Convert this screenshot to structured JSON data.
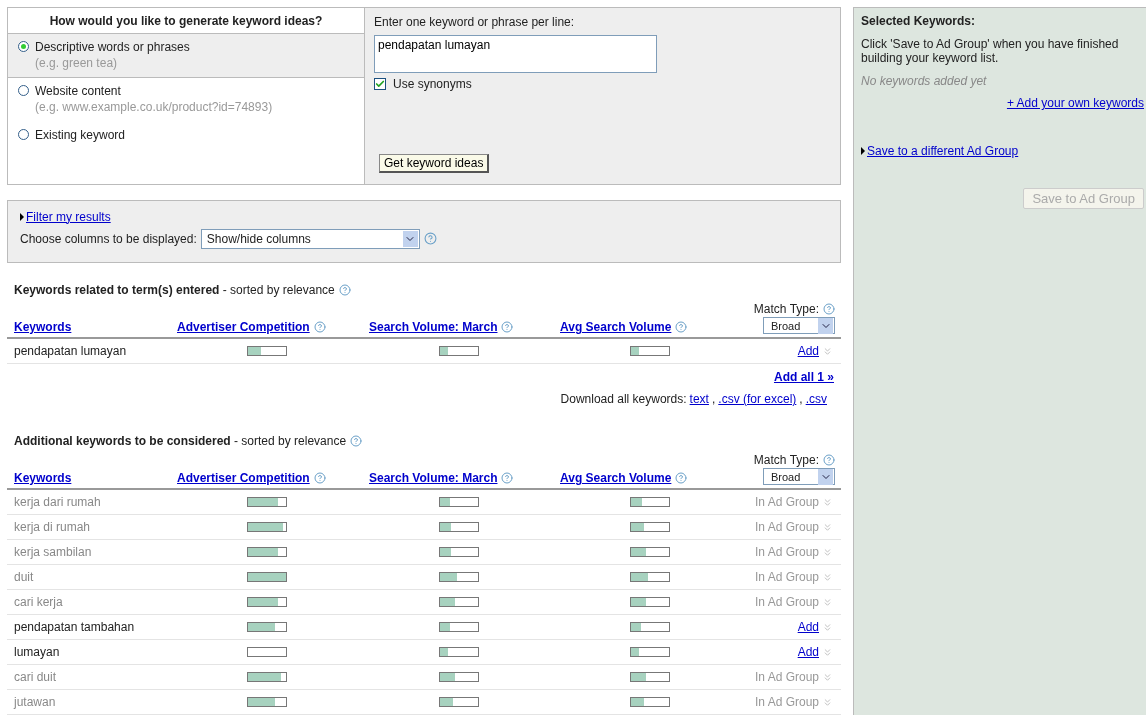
{
  "generator": {
    "title": "How would you like to generate keyword ideas?",
    "options": [
      {
        "label": "Descriptive words or phrases",
        "example": "(e.g. green tea)",
        "selected": true
      },
      {
        "label": "Website content",
        "example": "(e.g. www.example.co.uk/product?id=74893)",
        "selected": false
      },
      {
        "label": "Existing keyword",
        "selected": false
      }
    ],
    "input_label": "Enter one keyword or phrase per line:",
    "input_value": "pendapatan lumayan",
    "synonyms": {
      "label": "Use synonyms",
      "checked": true
    },
    "button": "Get keyword ideas"
  },
  "filter": {
    "link": "Filter my results",
    "columns_label": "Choose columns to be displayed:",
    "columns_select": "Show/hide columns"
  },
  "tables": [
    {
      "title": "Keywords related to term(s) entered",
      "subtitle": " - sorted by relevance",
      "match_type_label": "Match Type:",
      "match_type": "Broad",
      "columns": [
        "Keywords",
        "Advertiser Competition",
        "Search Volume: March",
        "Avg Search Volume"
      ],
      "rows": [
        {
          "keyword": "pendapatan lumayan",
          "in_group": false,
          "action": "Add",
          "competition": {
            "level": 0.35
          },
          "march": {
            "level": 0.2
          },
          "avg": {
            "level": 0.2
          }
        }
      ],
      "add_all": "Add all 1 »",
      "download_label": "Download all keywords:",
      "downloads": [
        {
          "label": "text",
          "separator": ","
        },
        {
          "label": ".csv (for excel)",
          "separator": ","
        },
        {
          "label": ".csv"
        }
      ]
    },
    {
      "title": "Additional keywords to be considered",
      "subtitle": " - sorted by relevance",
      "match_type_label": "Match Type:",
      "match_type": "Broad",
      "columns": [
        "Keywords",
        "Advertiser Competition",
        "Search Volume: March",
        "Avg Search Volume"
      ],
      "rows": [
        {
          "keyword": "kerja dari rumah",
          "in_group": true,
          "action": "In Ad Group",
          "competition": {
            "level": 0.8
          },
          "march": {
            "level": 0.25
          },
          "avg": {
            "level": 0.3
          }
        },
        {
          "keyword": "kerja di rumah",
          "in_group": true,
          "action": "In Ad Group",
          "competition": {
            "level": 0.92
          },
          "march": {
            "level": 0.3
          },
          "avg": {
            "level": 0.35
          }
        },
        {
          "keyword": "kerja sambilan",
          "in_group": true,
          "action": "In Ad Group",
          "competition": {
            "level": 0.8
          },
          "march": {
            "level": 0.3
          },
          "avg": {
            "level": 0.4
          }
        },
        {
          "keyword": "duit",
          "in_group": true,
          "action": "In Ad Group",
          "competition": {
            "level": 1
          },
          "march": {
            "level": 0.45
          },
          "avg": {
            "level": 0.45
          }
        },
        {
          "keyword": "cari kerja",
          "in_group": true,
          "action": "In Ad Group",
          "competition": {
            "level": 0.8
          },
          "march": {
            "level": 0.4
          },
          "avg": {
            "level": 0.4
          }
        },
        {
          "keyword": "pendapatan tambahan",
          "in_group": false,
          "action": "Add",
          "competition": {
            "level": 0.72
          },
          "march": {
            "level": 0.25
          },
          "avg": {
            "level": 0.25
          }
        },
        {
          "keyword": "lumayan",
          "in_group": false,
          "action": "Add",
          "competition": {
            "level": 0
          },
          "march": {
            "level": 0.2
          },
          "avg": {
            "level": 0.2
          }
        },
        {
          "keyword": "cari duit",
          "in_group": true,
          "action": "In Ad Group",
          "competition": {
            "level": 0.88
          },
          "march": {
            "level": 0.4
          },
          "avg": {
            "level": 0.4
          }
        },
        {
          "keyword": "jutawan",
          "in_group": true,
          "action": "In Ad Group",
          "competition": {
            "level": 0.72
          },
          "march": {
            "level": 0.35
          },
          "avg": {
            "level": 0.35
          }
        }
      ]
    }
  ],
  "selected_panel": {
    "title": "Selected Keywords:",
    "instruction": "Click 'Save to Ad Group' when you have finished building your keyword list.",
    "empty_note": "No keywords added yet",
    "add_own_link": "+ Add your own keywords",
    "save_different_link": "Save to a different Ad Group",
    "save_button": {
      "label": "Save to Ad Group",
      "disabled": true
    }
  }
}
